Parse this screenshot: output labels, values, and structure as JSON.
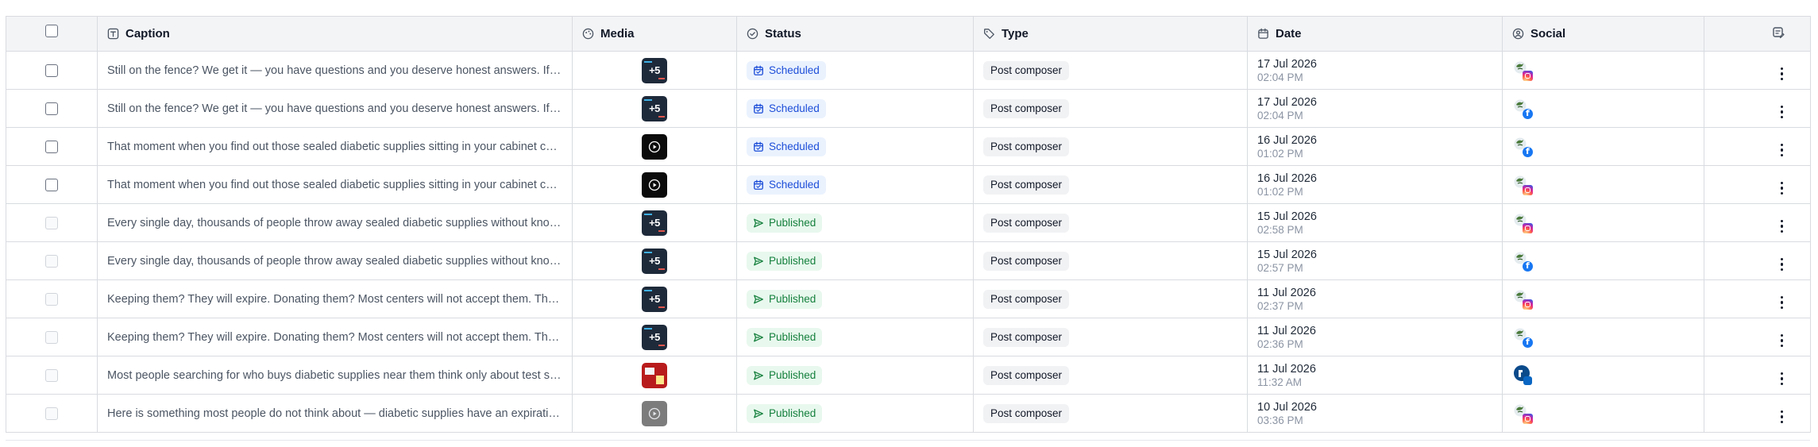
{
  "columns": {
    "caption": "Caption",
    "media": "Media",
    "status": "Status",
    "type": "Type",
    "date": "Date",
    "social": "Social"
  },
  "rows": [
    {
      "caption": "Still on the fence? We get it — you have questions and you deserve honest answers. If you've been thinking about selling",
      "media": "promo",
      "status": "Scheduled",
      "type": "Post composer",
      "date": "17 Jul 2026",
      "time": "02:04 PM",
      "social": "instagram",
      "selectable": true
    },
    {
      "caption": "Still on the fence? We get it — you have questions and you deserve honest answers. If you've been thinking about selling",
      "media": "promo",
      "status": "Scheduled",
      "type": "Post composer",
      "date": "17 Jul 2026",
      "time": "02:04 PM",
      "social": "facebook",
      "selectable": true
    },
    {
      "caption": "That moment when you find out those sealed diabetic supplies sitting in your cabinet could be worth real money",
      "media": "video",
      "status": "Scheduled",
      "type": "Post composer",
      "date": "16 Jul 2026",
      "time": "01:02 PM",
      "social": "facebook",
      "selectable": true
    },
    {
      "caption": "That moment when you find out those sealed diabetic supplies sitting in your cabinet could be worth real money",
      "media": "video",
      "status": "Scheduled",
      "type": "Post composer",
      "date": "16 Jul 2026",
      "time": "01:02 PM",
      "social": "instagram",
      "selectable": true
    },
    {
      "caption": "Every single day, thousands of people throw away sealed diabetic supplies without knowing they could sell them",
      "media": "promo",
      "status": "Published",
      "type": "Post composer",
      "date": "15 Jul 2026",
      "time": "02:58 PM",
      "social": "instagram",
      "selectable": false
    },
    {
      "caption": "Every single day, thousands of people throw away sealed diabetic supplies without knowing they could sell them",
      "media": "promo",
      "status": "Published",
      "type": "Post composer",
      "date": "15 Jul 2026",
      "time": "02:57 PM",
      "social": "facebook",
      "selectable": false
    },
    {
      "caption": "Keeping them? They will expire. Donating them? Most centers will not accept them. Throwing them away? That is money lost",
      "media": "promo",
      "status": "Published",
      "type": "Post composer",
      "date": "11 Jul 2026",
      "time": "02:37 PM",
      "social": "instagram",
      "selectable": false
    },
    {
      "caption": "Keeping them? They will expire. Donating them? Most centers will not accept them. Throwing them away? That is money lost",
      "media": "promo",
      "status": "Published",
      "type": "Post composer",
      "date": "11 Jul 2026",
      "time": "02:36 PM",
      "social": "facebook",
      "selectable": false
    },
    {
      "caption": "Most people searching for who buys diabetic supplies near them think only about test strips, but there is more",
      "media": "red",
      "status": "Published",
      "type": "Post composer",
      "date": "11 Jul 2026",
      "time": "11:32 AM",
      "social": "linkedin",
      "selectable": false
    },
    {
      "caption": "Here is something most people do not think about — diabetic supplies have an expiration date and lose value",
      "media": "grey-video",
      "status": "Published",
      "type": "Post composer",
      "date": "10 Jul 2026",
      "time": "03:36 PM",
      "social": "instagram",
      "selectable": false
    }
  ],
  "colors": {
    "scheduled": "#1d4ed8",
    "published": "#15803d",
    "header_bg": "#f3f4f6",
    "border": "#d8dbe0"
  }
}
